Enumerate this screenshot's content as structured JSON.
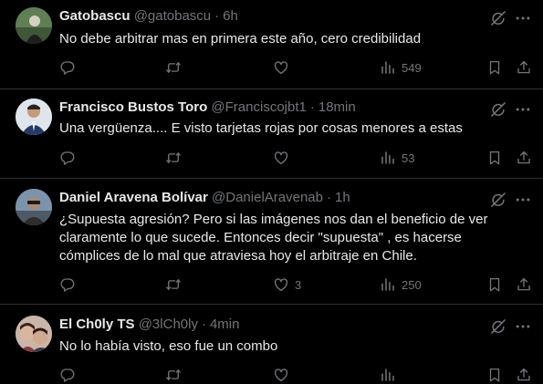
{
  "tweets": [
    {
      "name": "Gatobascu",
      "handle": "@gatobascu",
      "time": "6h",
      "text": "No debe arbitrar mas en primera este año, cero credibilidad",
      "likes": "",
      "views": "549"
    },
    {
      "name": "Francisco Bustos Toro",
      "handle": "@Franciscojbt1",
      "time": "18min",
      "text": "Una vergüenza.... E visto tarjetas rojas por cosas menores a estas",
      "likes": "",
      "views": "53"
    },
    {
      "name": "Daniel Aravena Bolívar",
      "handle": "@DanielAravenab",
      "time": "1h",
      "text": "¿Supuesta agresión? Pero si las imágenes nos dan el beneficio de ver claramente lo que sucede. Entonces decir \"supuesta\" , es hacerse cómplices de lo mal que atraviesa hoy el arbitraje en Chile.",
      "likes": "3",
      "views": "250"
    },
    {
      "name": "El Ch0ly TS",
      "handle": "@3lCh0ly",
      "time": "4min",
      "text": "No lo había visto, eso fue un combo",
      "likes": "",
      "views": ""
    }
  ],
  "separator": "·",
  "icons": {
    "reply": "reply-icon",
    "retweet": "retweet-icon",
    "like": "like-icon",
    "views": "views-icon",
    "bookmark": "bookmark-icon",
    "share": "share-icon",
    "grok": "grok-icon",
    "more": "more-icon"
  },
  "colors": {
    "background": "#000000",
    "text": "#e7e9ea",
    "secondary": "#71767b",
    "border": "#2f3336"
  }
}
